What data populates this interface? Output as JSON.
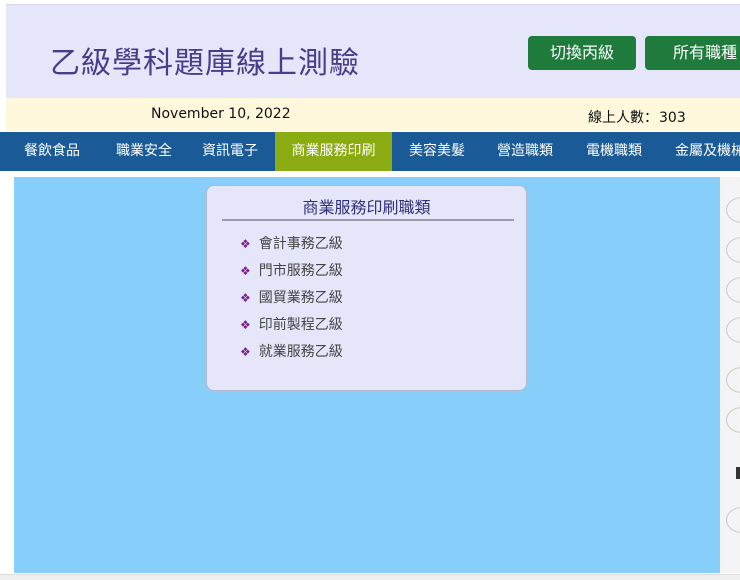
{
  "header": {
    "title": "乙級學科題庫線上測驗",
    "switch_button": "切換丙級",
    "all_jobs_button": "所有職種"
  },
  "infobar": {
    "date": "November 10, 2022",
    "online_label": "線上人數：",
    "online_count": "303"
  },
  "nav": {
    "items": [
      {
        "label": "餐飲食品"
      },
      {
        "label": "職業安全"
      },
      {
        "label": "資訊電子"
      },
      {
        "label": "商業服務印刷",
        "active": true
      },
      {
        "label": "美容美髮"
      },
      {
        "label": "營造職類"
      },
      {
        "label": "電機職類"
      },
      {
        "label": "金屬及機械"
      }
    ]
  },
  "card": {
    "title": "商業服務印刷職類",
    "bullet_icon": "diamond-bullet-icon",
    "items": [
      "會計事務乙級",
      "門市服務乙級",
      "國貿業務乙級",
      "印前製程乙級",
      "就業服務乙級"
    ]
  },
  "colors": {
    "header_bg": "#e6e6fa",
    "title_color": "#483d8b",
    "button_green": "#1e7b3c",
    "infobar_bg": "#fff8dc",
    "nav_bg": "#1a5a96",
    "nav_active": "#8bab12",
    "content_bg": "#87cefa",
    "bullet_purple": "#7a1f8c"
  }
}
